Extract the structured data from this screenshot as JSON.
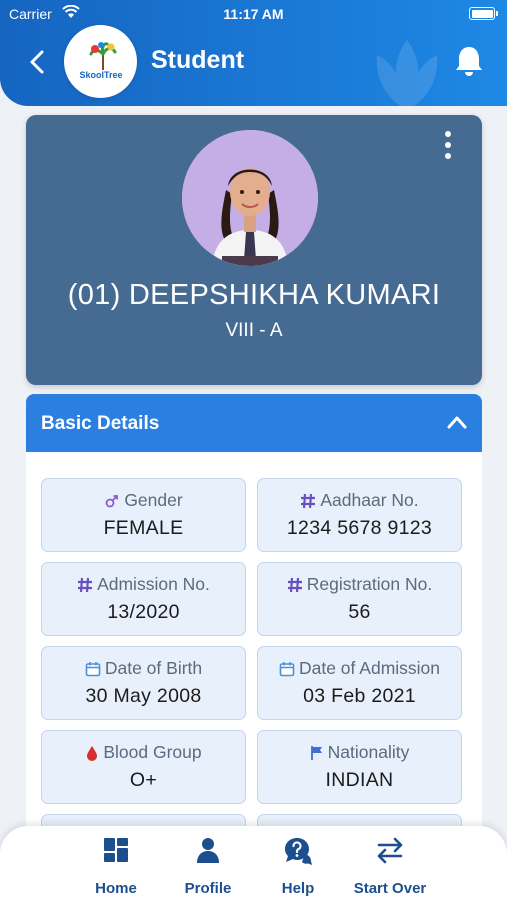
{
  "status_bar": {
    "carrier": "Carrier",
    "time": "11:17 AM"
  },
  "header": {
    "title": "Student",
    "logo_text": "SkoolTree"
  },
  "profile": {
    "name": "(01) DEEPSHIKHA KUMARI",
    "class": "VIII - A"
  },
  "basic_details": {
    "title": "Basic Details",
    "fields": [
      {
        "label": "Gender",
        "value": "FEMALE",
        "icon": "gender-icon"
      },
      {
        "label": "Aadhaar No.",
        "value": "1234 5678 9123",
        "icon": "hash-icon"
      },
      {
        "label": "Admission No.",
        "value": "13/2020",
        "icon": "hash-icon"
      },
      {
        "label": "Registration No.",
        "value": "56",
        "icon": "hash-icon"
      },
      {
        "label": "Date of Birth",
        "value": "30 May 2008",
        "icon": "calendar-icon"
      },
      {
        "label": "Date of Admission",
        "value": "03 Feb 2021",
        "icon": "calendar-icon"
      },
      {
        "label": "Blood Group",
        "value": "O+",
        "icon": "blood-drop-icon"
      },
      {
        "label": "Nationality",
        "value": "INDIAN",
        "icon": "flag-icon"
      }
    ]
  },
  "nav": [
    {
      "label": "Home",
      "icon": "grid-icon"
    },
    {
      "label": "Profile",
      "icon": "person-icon"
    },
    {
      "label": "Help",
      "icon": "help-chat-icon"
    },
    {
      "label": "Start Over",
      "icon": "swap-arrows-icon"
    }
  ],
  "colors": {
    "primary": "#1e88e5",
    "card": "#456b93",
    "nav_text": "#1d4f8f",
    "accent_purple": "#6a4fc4",
    "blood": "#d32f2f"
  }
}
